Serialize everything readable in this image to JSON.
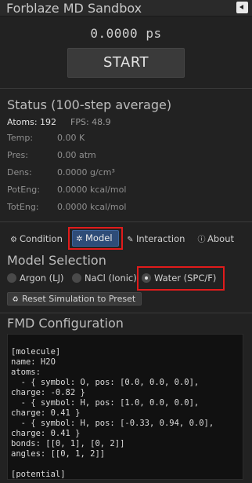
{
  "window": {
    "title": "Forblaze MD Sandbox",
    "collapse_icon": "triangle-left-icon"
  },
  "sim": {
    "time": "0.0000 ps",
    "start_label": "START"
  },
  "status": {
    "heading": "Status (100-step average)",
    "atoms": "Atoms: 192",
    "fps": "FPS: 48.9",
    "rows": [
      {
        "label": "Temp:",
        "value": "0.00 K"
      },
      {
        "label": "Pres:",
        "value": "0.00 atm"
      },
      {
        "label": "Dens:",
        "value": "0.0000 g/cm³"
      },
      {
        "label": "PotEng:",
        "value": "0.0000 kcal/mol"
      },
      {
        "label": "TotEng:",
        "value": "0.0000 kcal/mol"
      }
    ]
  },
  "tabs": [
    {
      "label": "Condition",
      "icon": "gear-icon",
      "glyph": "⚙"
    },
    {
      "label": "Model",
      "icon": "atom-icon",
      "glyph": "✲",
      "active": true
    },
    {
      "label": "Interaction",
      "icon": "pencil-icon",
      "glyph": "✎"
    },
    {
      "label": "About",
      "icon": "info-icon",
      "glyph": "ⓘ"
    }
  ],
  "model": {
    "heading": "Model Selection",
    "options": [
      {
        "label": "Argon (LJ)",
        "selected": false
      },
      {
        "label": "NaCl (Ionic)",
        "selected": false
      },
      {
        "label": "Water (SPC/F)",
        "selected": true
      }
    ],
    "reset_label": "Reset Simulation to Preset",
    "reset_icon": "reset-icon"
  },
  "config": {
    "heading": "FMD Configuration",
    "lines": [
      "[molecule]",
      "name: H2O",
      "atoms:",
      "  - { symbol: O, pos: [0.0, 0.0, 0.0],",
      "charge: -0.82 }",
      "  - { symbol: H, pos: [1.0, 0.0, 0.0],",
      "charge: 0.41 }",
      "  - { symbol: H, pos: [-0.33, 0.94, 0.0],",
      "charge: 0.41 }",
      "bonds: [[0, 1], [0, 2]]",
      "angles: [[0, 1, 2]]",
      "",
      "[potential]"
    ]
  },
  "colors": {
    "background": "#222222",
    "accent": "#2e4c78",
    "highlight": "#e11b1b"
  }
}
